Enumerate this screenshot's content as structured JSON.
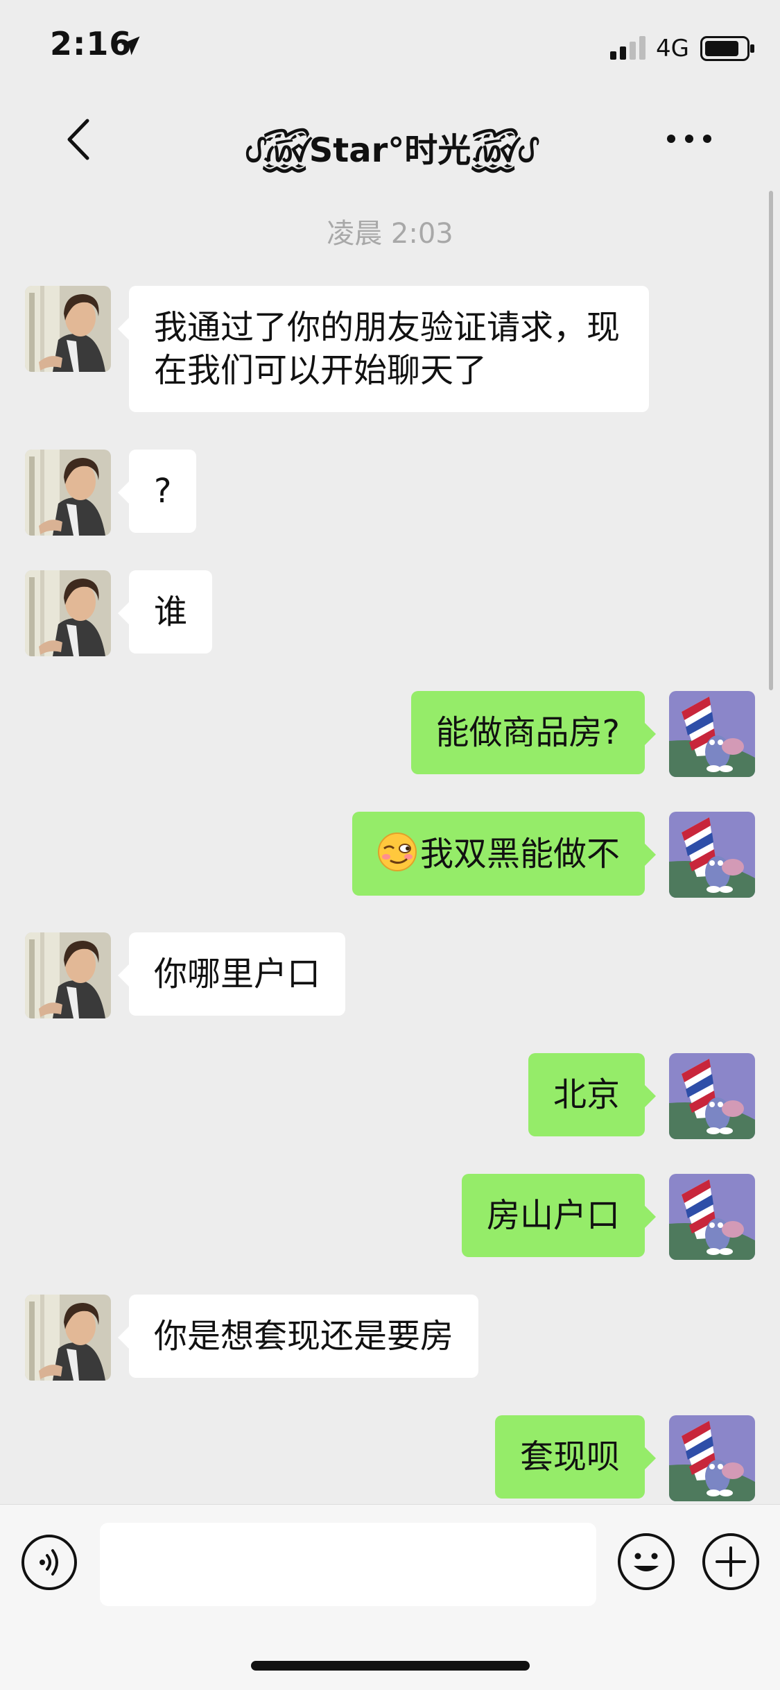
{
  "status_bar": {
    "time": "2:16",
    "network": "4G",
    "icons": [
      "location-arrow-icon",
      "signal-icon",
      "battery-icon"
    ]
  },
  "nav": {
    "title": "ᦔ꫞Star°时光꫞ᦔ",
    "icons": [
      "chevron-left-icon",
      "more-icon"
    ]
  },
  "chat": {
    "timestamp": "凌晨 2:03",
    "messages": [
      {
        "side": "in",
        "text": "我通过了你的朋友验证请求，现在我们可以开始聊天了"
      },
      {
        "side": "in",
        "text": "?"
      },
      {
        "side": "in",
        "text": "谁"
      },
      {
        "side": "out",
        "text": "能做商品房?"
      },
      {
        "side": "out",
        "emoji": "smirk-emoji",
        "text": "我双黑能做不"
      },
      {
        "side": "in",
        "text": "你哪里户口"
      },
      {
        "side": "out",
        "text": "北京"
      },
      {
        "side": "out",
        "text": "房山户口"
      },
      {
        "side": "in",
        "text": "你是想套现还是要房"
      },
      {
        "side": "out",
        "text": "套现呗"
      }
    ]
  },
  "input_bar": {
    "value": "",
    "icons": [
      "voice-icon",
      "emoji-icon",
      "plus-icon"
    ]
  },
  "colors": {
    "background": "#ededed",
    "incoming_bubble": "#ffffff",
    "outgoing_bubble": "#95ec69",
    "timestamp_text": "#a8a8a8"
  }
}
